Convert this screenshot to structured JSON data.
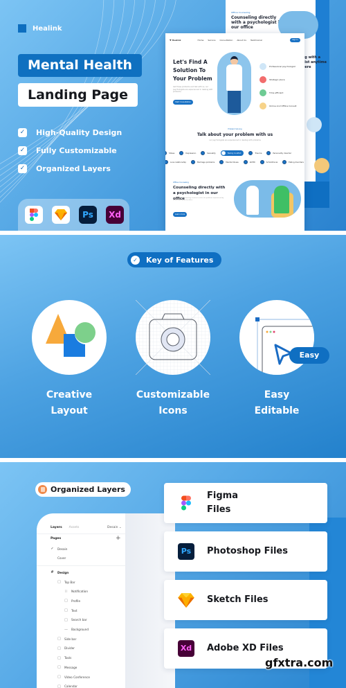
{
  "hero": {
    "brand": "Healink",
    "title_line1": "Mental Health",
    "title_line2": "Landing Page",
    "checklist": [
      {
        "label": "High-Quality  Design"
      },
      {
        "label": "Fully Customizable"
      },
      {
        "label": "Organized Layers"
      }
    ],
    "apps": [
      {
        "name": "Figma",
        "icon": "figma-icon",
        "text": ""
      },
      {
        "name": "Sketch",
        "icon": "sketch-icon",
        "text": ""
      },
      {
        "name": "Photoshop",
        "icon": "photoshop-icon",
        "text": "Ps"
      },
      {
        "name": "Adobe XD",
        "icon": "adobe-xd-icon",
        "text": "Xd"
      }
    ]
  },
  "mockup": {
    "logo": "♥ Healink",
    "nav_links": [
      "Home",
      "Service",
      "Consultation",
      "About Us",
      "Testimonial"
    ],
    "signin": "Sign In",
    "hero_title": "Let's Find A Solution To Your Problem",
    "hero_sub": "Get these problems and talk with us, our psychologists are experienced in dealing with problems",
    "hero_cta": "Start Consultation",
    "features": [
      {
        "label": "Professional psychologist",
        "color": "#cfe6f7"
      },
      {
        "label": "Strategic place",
        "color": "#f26d6d"
      },
      {
        "label": "Time efficient",
        "color": "#6ecb94"
      },
      {
        "label": "Online And Offline Consult",
        "color": "#f7d389"
      }
    ],
    "problem_eyebrow": "Problem Solving",
    "problem_title": "Talk about your problem with us",
    "problem_sub": "our psychologists are experienced in dealing with problems",
    "chips_row1": [
      {
        "label": "Stress",
        "active": false
      },
      {
        "label": "Depression",
        "active": false
      },
      {
        "label": "Sexuality",
        "active": false
      },
      {
        "label": "Family Conflict",
        "active": true
      },
      {
        "label": "Trauma",
        "active": false
      },
      {
        "label": "Personality disorder",
        "active": false
      }
    ],
    "chips_row2": [
      {
        "label": "Love relationship",
        "active": false
      },
      {
        "label": "Marriage problems",
        "active": false
      },
      {
        "label": "Mental Illness",
        "active": false
      },
      {
        "label": "ADHD",
        "active": false
      },
      {
        "label": "Schizofrenia",
        "active": false
      },
      {
        "label": "Eating disorders",
        "active": false
      }
    ],
    "office_eyebrow": "Offline Counseling",
    "office_title": "Counseling directly with a psychologist in our office",
    "office_body": "The process of counseling services to solve the problems experienced by clients, directly at the office.",
    "office_cta": "Learn more",
    "back_eyebrow": "Offline Counseling",
    "back_title": "Counseling directly with a psychologist in our office",
    "back_title2": "...ng with a ...gist anytime ...here"
  },
  "features_section": {
    "badge": "Key of Features",
    "items": [
      {
        "label_line1": "Creative",
        "label_line2": "Layout",
        "icon": "shapes-icon"
      },
      {
        "label_line1": "Customizable",
        "label_line2": "Icons",
        "icon": "camera-grid-icon"
      },
      {
        "label_line1": "Easy",
        "label_line2": "Editable",
        "icon": "cursor-window-icon",
        "badge": "Easy"
      }
    ]
  },
  "layers_section": {
    "badge": "Organized Layers",
    "panel": {
      "tab_active": "Layers",
      "tab_inactive": "Assets",
      "page_select": "Desain ⌄",
      "pages_heading": "Pages",
      "pages": [
        {
          "label": "Desain",
          "checked": true
        },
        {
          "label": "Cover",
          "checked": false
        }
      ],
      "frame": "Design",
      "layers": [
        {
          "label": "Top Bar",
          "depth": 1,
          "glyph": "□"
        },
        {
          "label": "Notification",
          "depth": 2,
          "glyph": "⁞⁞"
        },
        {
          "label": "Profile",
          "depth": 2,
          "glyph": "□"
        },
        {
          "label": "Text",
          "depth": 2,
          "glyph": "□"
        },
        {
          "label": "Search bar",
          "depth": 2,
          "glyph": "□"
        },
        {
          "label": "Background",
          "depth": 2,
          "glyph": "—"
        },
        {
          "label": "Side bar",
          "depth": 1,
          "glyph": "□"
        },
        {
          "label": "Divider",
          "depth": 1,
          "glyph": "□"
        },
        {
          "label": "Tools",
          "depth": 1,
          "glyph": "□"
        },
        {
          "label": "Message",
          "depth": 1,
          "glyph": "□"
        },
        {
          "label": "Video Conference",
          "depth": 1,
          "glyph": "□"
        },
        {
          "label": "Calendar",
          "depth": 1,
          "glyph": "□"
        }
      ]
    },
    "files": [
      {
        "label": "Figma Files",
        "icon": "figma-icon"
      },
      {
        "label": "Photoshop Files",
        "icon": "photoshop-icon",
        "text": "Ps"
      },
      {
        "label": "Sketch Files",
        "icon": "sketch-icon"
      },
      {
        "label": "Adobe XD Files",
        "icon": "adobe-xd-icon",
        "text": "Xd"
      }
    ],
    "watermark": "gfxtra.com"
  },
  "colors": {
    "brand_blue": "#0f70c0",
    "bg_light": "#7cc4f4",
    "bg_dark": "#2381cc"
  }
}
